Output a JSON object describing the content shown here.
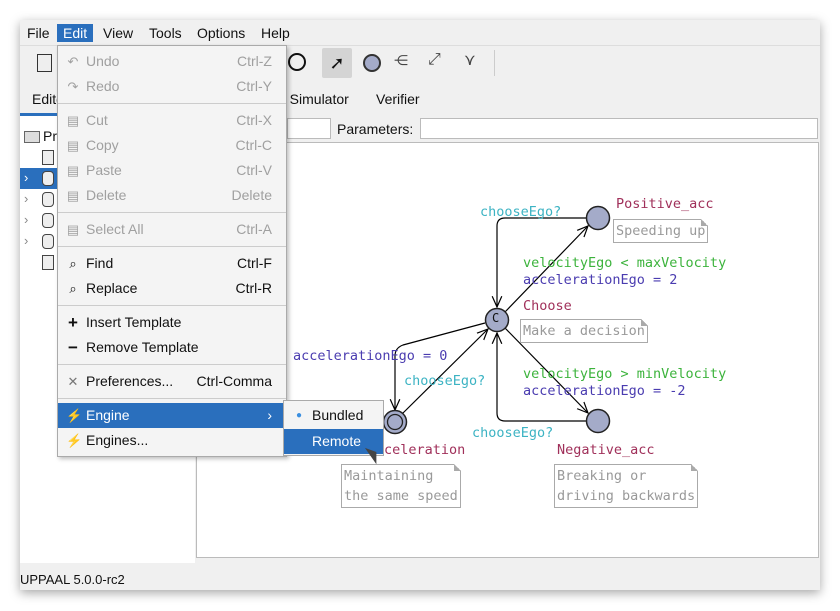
{
  "menubar": [
    "File",
    "Edit",
    "View",
    "Tools",
    "Options",
    "Help"
  ],
  "tabs": {
    "editor": "Edito",
    "simulator": "e Simulator",
    "verifier": "Verifier"
  },
  "template_bar": {
    "parameters_label": "Parameters:",
    "name_value": "",
    "parameters_value": ""
  },
  "tree": {
    "root": "Pr"
  },
  "edit_menu": {
    "items": [
      {
        "label": "Undo",
        "shortcut": "Ctrl-Z",
        "icon": "undo-icon",
        "enabled": false
      },
      {
        "label": "Redo",
        "shortcut": "Ctrl-Y",
        "icon": "redo-icon",
        "enabled": false
      },
      {
        "label": "Cut",
        "shortcut": "Ctrl-X",
        "icon": "cut-icon",
        "enabled": false
      },
      {
        "label": "Copy",
        "shortcut": "Ctrl-C",
        "icon": "copy-icon",
        "enabled": false
      },
      {
        "label": "Paste",
        "shortcut": "Ctrl-V",
        "icon": "paste-icon",
        "enabled": false
      },
      {
        "label": "Delete",
        "shortcut": "Delete",
        "icon": "delete-icon",
        "enabled": false
      },
      {
        "label": "Select All",
        "shortcut": "Ctrl-A",
        "icon": "select-all-icon",
        "enabled": false
      },
      {
        "label": "Find",
        "shortcut": "Ctrl-F",
        "icon": "find-icon",
        "enabled": true
      },
      {
        "label": "Replace",
        "shortcut": "Ctrl-R",
        "icon": "replace-icon",
        "enabled": true
      },
      {
        "label": "Insert Template",
        "shortcut": "",
        "icon": "plus-icon",
        "enabled": true
      },
      {
        "label": "Remove Template",
        "shortcut": "",
        "icon": "minus-icon",
        "enabled": true
      },
      {
        "label": "Preferences...",
        "shortcut": "Ctrl-Comma",
        "icon": "wrench-icon",
        "enabled": true
      },
      {
        "label": "Engine",
        "shortcut": "",
        "icon": "plug-icon",
        "enabled": true,
        "highlighted": true
      },
      {
        "label": "Engines...",
        "shortcut": "",
        "icon": "plug-icon",
        "enabled": true
      }
    ]
  },
  "engine_submenu": {
    "items": [
      {
        "label": "Bundled",
        "selected": true
      },
      {
        "label": "Remote",
        "highlighted": true
      }
    ]
  },
  "diagram": {
    "locations": {
      "positive": "Positive_acc",
      "choose": "Choose",
      "negative": "Negative_acc",
      "constant": "celeration"
    },
    "notes": {
      "positive": "Speeding up",
      "choose": "Make a decision",
      "constant": [
        "Maintaining",
        "the same speed"
      ],
      "negative": [
        "Breaking or",
        "driving backwards"
      ]
    },
    "committed_mark": "C",
    "sync1": "chooseEgo?",
    "sync2": "chooseEgo?",
    "sync3": "chooseEgo?",
    "guard_pos": "velocityEgo < maxVelocity",
    "update_pos": "accelerationEgo = 2",
    "guard_neg": "velocityEgo > minVelocity",
    "update_neg": "accelerationEgo = -2",
    "update_const": "accelerationEgo = 0"
  },
  "colors": {
    "accent": "#2a6fbd",
    "sync": "#3cb3c3",
    "guard": "#3cb33c",
    "update": "#4a3cb0",
    "location_name": "#a0305a",
    "node_fill": "#a4abc9"
  },
  "status": "UPPAAL 5.0.0-rc2"
}
